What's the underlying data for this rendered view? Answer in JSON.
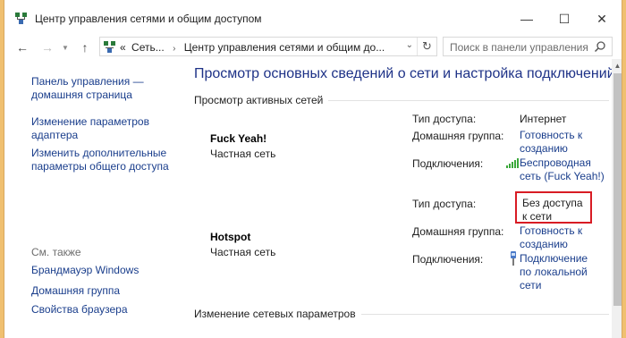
{
  "window": {
    "title": "Центр управления сетями и общим доступом",
    "minimize": "—",
    "maximize": "☐",
    "close": "✕"
  },
  "nav": {
    "back": "←",
    "forward": "→",
    "up": "↑",
    "breadcrumb_overflow": "«",
    "crumb1": "Сеть...",
    "crumb2": "Центр управления сетями и общим до...",
    "search_placeholder": "Поиск в панели управления"
  },
  "sidebar": {
    "home": "Панель управления — домашняя страница",
    "adapter": "Изменение параметров адаптера",
    "sharing": "Изменить дополнительные параметры общего доступа",
    "see_also": "См. также",
    "firewall": "Брандмауэр Windows",
    "homegroup": "Домашняя группа",
    "browser": "Свойства браузера"
  },
  "main": {
    "title": "Просмотр основных сведений о сети и настройка подключений",
    "active_networks": "Просмотр активных сетей",
    "change_settings": "Изменение сетевых параметров",
    "labels": {
      "access_type": "Тип доступа:",
      "homegroup": "Домашняя группа:",
      "connections": "Подключения:"
    },
    "networks": [
      {
        "name": "Fuck Yeah!",
        "type": "Частная сеть",
        "access": "Интернет",
        "homegroup": "Готовность к созданию",
        "connection": "Беспроводная сеть (Fuck Yeah!)"
      },
      {
        "name": "Hotspot",
        "type": "Частная сеть",
        "access": "Без доступа к сети",
        "homegroup": "Готовность к созданию",
        "connection": "Подключение по локальной сети"
      }
    ]
  },
  "colors": {
    "link": "#1a3e8c",
    "title": "#1e3287",
    "highlight": "#d81c24"
  }
}
